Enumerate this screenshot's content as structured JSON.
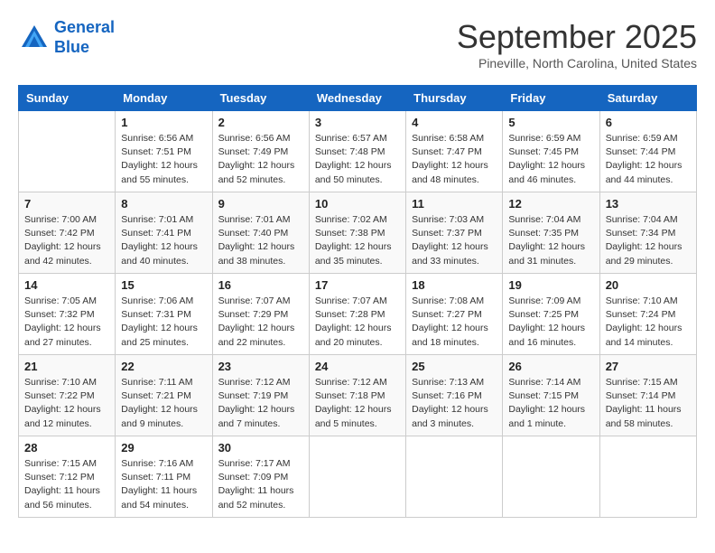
{
  "header": {
    "logo_line1": "General",
    "logo_line2": "Blue",
    "month": "September 2025",
    "location": "Pineville, North Carolina, United States"
  },
  "days_of_week": [
    "Sunday",
    "Monday",
    "Tuesday",
    "Wednesday",
    "Thursday",
    "Friday",
    "Saturday"
  ],
  "weeks": [
    [
      {
        "day": "",
        "info": ""
      },
      {
        "day": "1",
        "info": "Sunrise: 6:56 AM\nSunset: 7:51 PM\nDaylight: 12 hours\nand 55 minutes."
      },
      {
        "day": "2",
        "info": "Sunrise: 6:56 AM\nSunset: 7:49 PM\nDaylight: 12 hours\nand 52 minutes."
      },
      {
        "day": "3",
        "info": "Sunrise: 6:57 AM\nSunset: 7:48 PM\nDaylight: 12 hours\nand 50 minutes."
      },
      {
        "day": "4",
        "info": "Sunrise: 6:58 AM\nSunset: 7:47 PM\nDaylight: 12 hours\nand 48 minutes."
      },
      {
        "day": "5",
        "info": "Sunrise: 6:59 AM\nSunset: 7:45 PM\nDaylight: 12 hours\nand 46 minutes."
      },
      {
        "day": "6",
        "info": "Sunrise: 6:59 AM\nSunset: 7:44 PM\nDaylight: 12 hours\nand 44 minutes."
      }
    ],
    [
      {
        "day": "7",
        "info": "Sunrise: 7:00 AM\nSunset: 7:42 PM\nDaylight: 12 hours\nand 42 minutes."
      },
      {
        "day": "8",
        "info": "Sunrise: 7:01 AM\nSunset: 7:41 PM\nDaylight: 12 hours\nand 40 minutes."
      },
      {
        "day": "9",
        "info": "Sunrise: 7:01 AM\nSunset: 7:40 PM\nDaylight: 12 hours\nand 38 minutes."
      },
      {
        "day": "10",
        "info": "Sunrise: 7:02 AM\nSunset: 7:38 PM\nDaylight: 12 hours\nand 35 minutes."
      },
      {
        "day": "11",
        "info": "Sunrise: 7:03 AM\nSunset: 7:37 PM\nDaylight: 12 hours\nand 33 minutes."
      },
      {
        "day": "12",
        "info": "Sunrise: 7:04 AM\nSunset: 7:35 PM\nDaylight: 12 hours\nand 31 minutes."
      },
      {
        "day": "13",
        "info": "Sunrise: 7:04 AM\nSunset: 7:34 PM\nDaylight: 12 hours\nand 29 minutes."
      }
    ],
    [
      {
        "day": "14",
        "info": "Sunrise: 7:05 AM\nSunset: 7:32 PM\nDaylight: 12 hours\nand 27 minutes."
      },
      {
        "day": "15",
        "info": "Sunrise: 7:06 AM\nSunset: 7:31 PM\nDaylight: 12 hours\nand 25 minutes."
      },
      {
        "day": "16",
        "info": "Sunrise: 7:07 AM\nSunset: 7:29 PM\nDaylight: 12 hours\nand 22 minutes."
      },
      {
        "day": "17",
        "info": "Sunrise: 7:07 AM\nSunset: 7:28 PM\nDaylight: 12 hours\nand 20 minutes."
      },
      {
        "day": "18",
        "info": "Sunrise: 7:08 AM\nSunset: 7:27 PM\nDaylight: 12 hours\nand 18 minutes."
      },
      {
        "day": "19",
        "info": "Sunrise: 7:09 AM\nSunset: 7:25 PM\nDaylight: 12 hours\nand 16 minutes."
      },
      {
        "day": "20",
        "info": "Sunrise: 7:10 AM\nSunset: 7:24 PM\nDaylight: 12 hours\nand 14 minutes."
      }
    ],
    [
      {
        "day": "21",
        "info": "Sunrise: 7:10 AM\nSunset: 7:22 PM\nDaylight: 12 hours\nand 12 minutes."
      },
      {
        "day": "22",
        "info": "Sunrise: 7:11 AM\nSunset: 7:21 PM\nDaylight: 12 hours\nand 9 minutes."
      },
      {
        "day": "23",
        "info": "Sunrise: 7:12 AM\nSunset: 7:19 PM\nDaylight: 12 hours\nand 7 minutes."
      },
      {
        "day": "24",
        "info": "Sunrise: 7:12 AM\nSunset: 7:18 PM\nDaylight: 12 hours\nand 5 minutes."
      },
      {
        "day": "25",
        "info": "Sunrise: 7:13 AM\nSunset: 7:16 PM\nDaylight: 12 hours\nand 3 minutes."
      },
      {
        "day": "26",
        "info": "Sunrise: 7:14 AM\nSunset: 7:15 PM\nDaylight: 12 hours\nand 1 minute."
      },
      {
        "day": "27",
        "info": "Sunrise: 7:15 AM\nSunset: 7:14 PM\nDaylight: 11 hours\nand 58 minutes."
      }
    ],
    [
      {
        "day": "28",
        "info": "Sunrise: 7:15 AM\nSunset: 7:12 PM\nDaylight: 11 hours\nand 56 minutes."
      },
      {
        "day": "29",
        "info": "Sunrise: 7:16 AM\nSunset: 7:11 PM\nDaylight: 11 hours\nand 54 minutes."
      },
      {
        "day": "30",
        "info": "Sunrise: 7:17 AM\nSunset: 7:09 PM\nDaylight: 11 hours\nand 52 minutes."
      },
      {
        "day": "",
        "info": ""
      },
      {
        "day": "",
        "info": ""
      },
      {
        "day": "",
        "info": ""
      },
      {
        "day": "",
        "info": ""
      }
    ]
  ]
}
